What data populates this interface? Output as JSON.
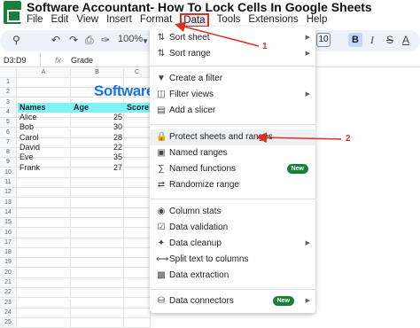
{
  "title": "Software Accountant- How To Lock Cells In Google Sheets",
  "menubar": [
    "File",
    "Edit",
    "View",
    "Insert",
    "Format",
    "Data",
    "Tools",
    "Extensions",
    "Help"
  ],
  "toolbar": {
    "zoom": "100%",
    "font_size": "10"
  },
  "formula_bar": {
    "cell_ref": "D3:D9",
    "fx": "fx",
    "value": "Grade"
  },
  "columns": [
    "A",
    "B",
    "C"
  ],
  "rows": [
    "1",
    "2",
    "3",
    "4",
    "5",
    "6",
    "7",
    "8",
    "9",
    "10",
    "11",
    "12",
    "13",
    "14",
    "15",
    "16",
    "17",
    "18",
    "19",
    "20",
    "21",
    "22",
    "23",
    "24",
    "25"
  ],
  "watermark": "Software Accountant",
  "table": {
    "headers": [
      "Names",
      "Age",
      "Score"
    ],
    "rows": [
      {
        "name": "Alice",
        "age": "",
        "score": "25"
      },
      {
        "name": "Bob",
        "age": "",
        "score": "30"
      },
      {
        "name": "Carol",
        "age": "",
        "score": "28"
      },
      {
        "name": "David",
        "age": "",
        "score": "22"
      },
      {
        "name": "Eve",
        "age": "",
        "score": "35"
      },
      {
        "name": "Frank",
        "age": "",
        "score": "27"
      }
    ]
  },
  "menu": {
    "items": [
      {
        "label": "Sort sheet",
        "icon": "sort-icon",
        "submenu": true
      },
      {
        "label": "Sort range",
        "icon": "sort-range-icon",
        "submenu": true
      },
      {
        "label": "Create a filter",
        "icon": "filter-icon"
      },
      {
        "label": "Filter views",
        "icon": "filter-views-icon",
        "submenu": true
      },
      {
        "label": "Add a slicer",
        "icon": "slicer-icon"
      },
      {
        "label": "Protect sheets and ranges",
        "icon": "lock-icon"
      },
      {
        "label": "Named ranges",
        "icon": "named-ranges-icon"
      },
      {
        "label": "Named functions",
        "icon": "function-icon",
        "badge": "New"
      },
      {
        "label": "Randomize range",
        "icon": "shuffle-icon"
      },
      {
        "label": "Column stats",
        "icon": "bulb-icon"
      },
      {
        "label": "Data validation",
        "icon": "validation-icon"
      },
      {
        "label": "Data cleanup",
        "icon": "cleanup-icon",
        "submenu": true
      },
      {
        "label": "Split text to columns",
        "icon": "split-icon"
      },
      {
        "label": "Data extraction",
        "icon": "extraction-icon"
      },
      {
        "label": "Data connectors",
        "icon": "database-icon",
        "badge": "New",
        "submenu": true
      }
    ]
  },
  "annotations": [
    "1",
    "2"
  ],
  "colors": {
    "accent_red": "#d93025",
    "header_cyan": "#7ff2f4",
    "badge_green": "#188038"
  }
}
